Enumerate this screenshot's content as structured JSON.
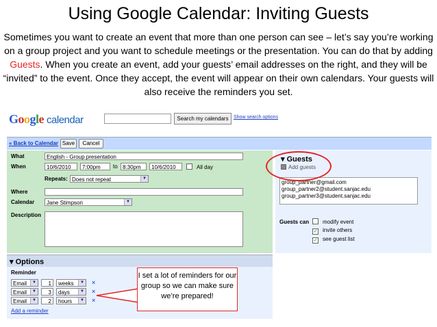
{
  "slide": {
    "title": "Using Google Calendar: Inviting Guests",
    "intro_before": "Sometimes you want to create an event that more than one person can see – let’s say you’re working on a group project and you want to schedule meetings or the presentation. You can do that by adding ",
    "intro_highlight": "Guests",
    "intro_after": ". When you create an event, add your guests’ email addresses on the right, and they will be “invited” to the event. Once they accept, the event will appear on their own calendars. Your guests will also receive the reminders you set.",
    "highlight_color": "#e32526"
  },
  "app": {
    "logo_letters": [
      "G",
      "o",
      "o",
      "g",
      "l",
      "e"
    ],
    "logo_suffix": "calendar",
    "search_value": "",
    "search_button": "Search my calendars",
    "show_options": "Show search options"
  },
  "toolbar": {
    "back": "« Back to Calendar",
    "save": "Save",
    "cancel": "Cancel"
  },
  "event": {
    "what_label": "What",
    "what_value": "English - Group presentation",
    "when_label": "When",
    "start_date": "10/6/2010",
    "start_time": "7:00pm",
    "to_label": "to",
    "end_time": "8:30pm",
    "end_date": "10/6/2010",
    "all_day_label": "All day",
    "repeats_label": "Repeats:",
    "repeats_value": "Does not repeat",
    "where_label": "Where",
    "where_value": "",
    "calendar_label": "Calendar",
    "calendar_value": "Jane Stimpson",
    "description_label": "Description",
    "description_value": ""
  },
  "guests": {
    "title": "Guests",
    "add_label": "Add guests",
    "list": [
      "group_partner@gmail.com",
      "group_partner2@student.sanjac.edu",
      "group_partner3@student.sanjac.edu"
    ],
    "can_label": "Guests can",
    "permissions": [
      {
        "label": "modify event",
        "checked": false
      },
      {
        "label": "invite others",
        "checked": true
      },
      {
        "label": "see guest list",
        "checked": true
      }
    ]
  },
  "options": {
    "title": "Options",
    "reminder_label": "Reminder",
    "reminders": [
      {
        "method": "Email",
        "amount": "1",
        "unit": "weeks"
      },
      {
        "method": "Email",
        "amount": "3",
        "unit": "days"
      },
      {
        "method": "Email",
        "amount": "2",
        "unit": "hours"
      }
    ],
    "add_reminder": "Add a reminder"
  },
  "callout": {
    "text": "I set a lot of reminders for our group so we can make sure we’re prepared!"
  }
}
